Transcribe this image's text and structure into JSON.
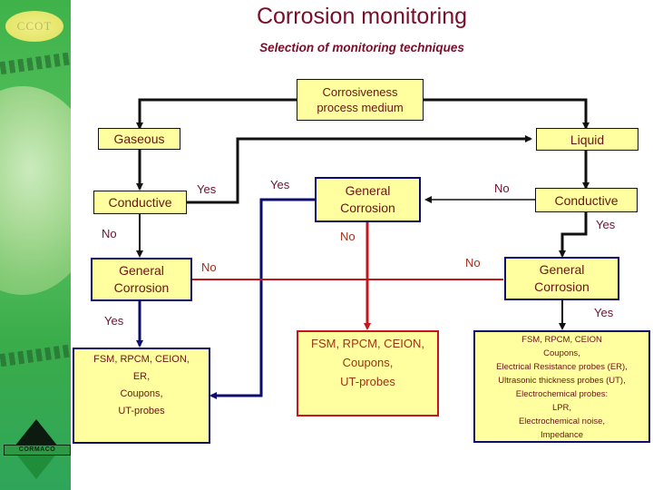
{
  "slide": {
    "title": "Corrosion monitoring",
    "subtitle": "Selection of monitoring techniques"
  },
  "logos": {
    "top_logo_text": "CCOT",
    "bottom_logo_text": "CORMACO"
  },
  "nodes": {
    "root": {
      "line1": "Corrosiveness",
      "line2": "process medium"
    },
    "gaseous": {
      "label": "Gaseous"
    },
    "liquid": {
      "label": "Liquid"
    },
    "gas_conductive": {
      "label": "Conductive"
    },
    "liq_conductive": {
      "label": "Conductive"
    },
    "center_general": {
      "line1": "General",
      "line2": "Corrosion"
    },
    "left_general": {
      "line1": "General",
      "line2": "Corrosion"
    },
    "right_general": {
      "line1": "General",
      "line2": "Corrosion"
    },
    "left_result": {
      "lines": [
        "FSM, RPCM, CEION,",
        "ER,",
        "Coupons,",
        "UT-probes"
      ]
    },
    "center_result": {
      "lines": [
        "FSM, RPCM, CEION,",
        "Coupons,",
        "UT-probes"
      ]
    },
    "right_result": {
      "lines": [
        "FSM, RPCM, CEION",
        "Coupons,",
        "Electrical Resistance probes (ER),",
        "Ultrasonic thickness probes (UT),",
        "Electrochemical probes:",
        "LPR,",
        "Electrochemical noise,",
        "Impedance"
      ]
    }
  },
  "edge_labels": {
    "gas_conductive_yes": "Yes",
    "gas_conductive_no": "No",
    "center_general_yes": "Yes",
    "center_general_no": "No",
    "liq_conductive_no": "No",
    "liq_conductive_yes": "Yes",
    "left_general_no": "No",
    "left_general_yes": "Yes",
    "right_general_no": "No",
    "right_general_yes": "Yes"
  },
  "colors": {
    "title": "#7a0d2a",
    "box_fill": "#ffffa0",
    "black_line": "#111111",
    "navy_line": "#0c0c6e",
    "red_line": "#c4161c",
    "sidebar_green": "#4cbb55"
  }
}
